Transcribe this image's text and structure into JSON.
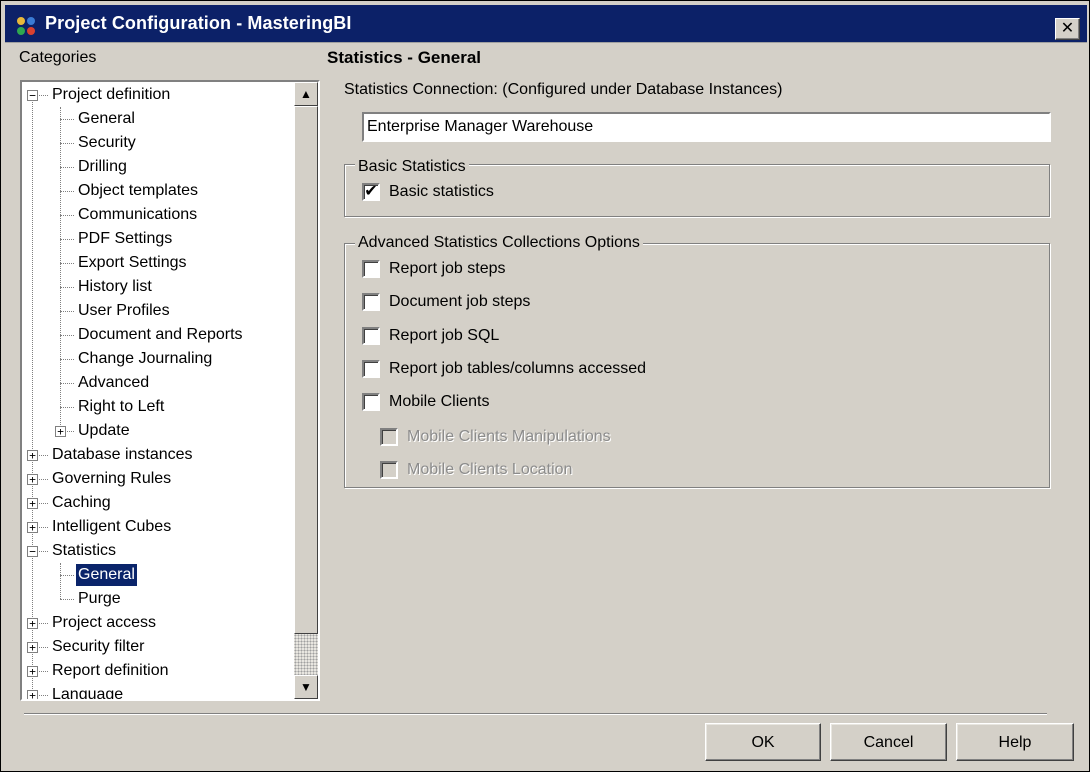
{
  "window": {
    "title": "Project Configuration - MasteringBI",
    "close_label": "✕"
  },
  "categories_label": "Categories",
  "section_title": "Statistics - General",
  "tree": [
    {
      "label": "Project definition",
      "level": 0,
      "expander": "−"
    },
    {
      "label": "General",
      "level": 1
    },
    {
      "label": "Security",
      "level": 1
    },
    {
      "label": "Drilling",
      "level": 1
    },
    {
      "label": "Object templates",
      "level": 1
    },
    {
      "label": "Communications",
      "level": 1
    },
    {
      "label": "PDF Settings",
      "level": 1
    },
    {
      "label": "Export Settings",
      "level": 1
    },
    {
      "label": "History list",
      "level": 1
    },
    {
      "label": "User Profiles",
      "level": 1
    },
    {
      "label": "Document and Reports",
      "level": 1
    },
    {
      "label": "Change Journaling",
      "level": 1
    },
    {
      "label": "Advanced",
      "level": 1
    },
    {
      "label": "Right to Left",
      "level": 1
    },
    {
      "label": "Update",
      "level": 1,
      "expander": "+"
    },
    {
      "label": "Database instances",
      "level": 0,
      "expander": "+"
    },
    {
      "label": "Governing Rules",
      "level": 0,
      "expander": "+"
    },
    {
      "label": "Caching",
      "level": 0,
      "expander": "+"
    },
    {
      "label": "Intelligent Cubes",
      "level": 0,
      "expander": "+"
    },
    {
      "label": "Statistics",
      "level": 0,
      "expander": "−"
    },
    {
      "label": "General",
      "level": 1,
      "selected": true
    },
    {
      "label": "Purge",
      "level": 1
    },
    {
      "label": "Project access",
      "level": 0,
      "expander": "+"
    },
    {
      "label": "Security filter",
      "level": 0,
      "expander": "+"
    },
    {
      "label": "Report definition",
      "level": 0,
      "expander": "+"
    },
    {
      "label": "Language",
      "level": 0,
      "expander": "+"
    }
  ],
  "scrollbar": {
    "up_icon": "▲",
    "down_icon": "▼"
  },
  "statistics_connection": {
    "label": "Statistics Connection: (Configured under Database Instances)",
    "value": "Enterprise Manager Warehouse"
  },
  "basic_statistics": {
    "legend": "Basic Statistics",
    "options": [
      {
        "label": "Basic statistics",
        "checked": true,
        "disabled": false
      }
    ]
  },
  "advanced_statistics": {
    "legend": "Advanced Statistics Collections Options",
    "options": [
      {
        "label": "Report job steps",
        "checked": false,
        "disabled": false
      },
      {
        "label": "Document job steps",
        "checked": false,
        "disabled": false
      },
      {
        "label": "Report job SQL",
        "checked": false,
        "disabled": false
      },
      {
        "label": "Report job tables/columns accessed",
        "checked": false,
        "disabled": false
      },
      {
        "label": "Mobile Clients",
        "checked": false,
        "disabled": false
      },
      {
        "label": "Mobile Clients Manipulations",
        "checked": false,
        "disabled": true
      },
      {
        "label": "Mobile Clients Location",
        "checked": false,
        "disabled": true
      }
    ]
  },
  "buttons": {
    "ok": "OK",
    "cancel": "Cancel",
    "help": "Help"
  },
  "colors": {
    "titlebar": "#0c2168",
    "dialog": "#d4d0c8",
    "selection": "#0a246a"
  }
}
